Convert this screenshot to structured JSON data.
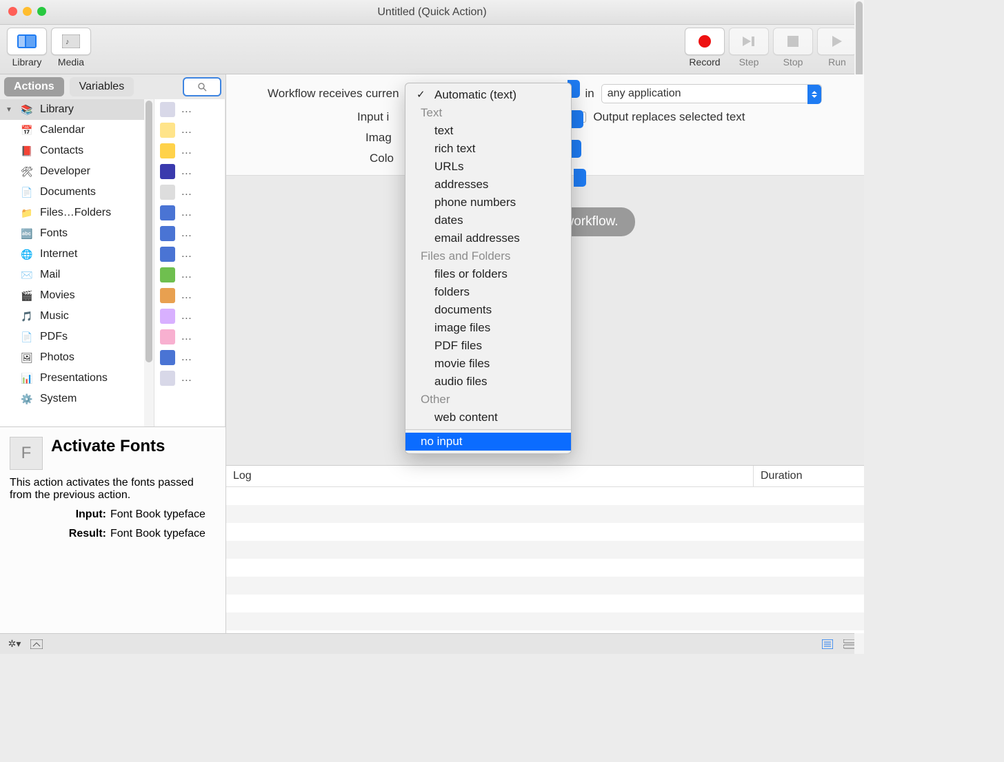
{
  "title": "Untitled (Quick Action)",
  "toolbar": {
    "library": "Library",
    "media": "Media",
    "record": "Record",
    "step": "Step",
    "stop": "Stop",
    "run": "Run"
  },
  "tabs": {
    "actions": "Actions",
    "variables": "Variables"
  },
  "sidebar": {
    "libraryHeader": "Library",
    "items": [
      {
        "label": "Calendar"
      },
      {
        "label": "Contacts"
      },
      {
        "label": "Developer"
      },
      {
        "label": "Documents"
      },
      {
        "label": "Files…Folders"
      },
      {
        "label": "Fonts"
      },
      {
        "label": "Internet"
      },
      {
        "label": "Mail"
      },
      {
        "label": "Movies"
      },
      {
        "label": "Music"
      },
      {
        "label": "PDFs"
      },
      {
        "label": "Photos"
      },
      {
        "label": "Presentations"
      },
      {
        "label": "System"
      }
    ]
  },
  "actions": {
    "rows": [
      "…",
      "…",
      "…",
      "…",
      "…",
      "…",
      "…",
      "…",
      "…",
      "…",
      "…",
      "…",
      "…",
      "…"
    ]
  },
  "detail": {
    "title": "Activate Fonts",
    "desc": "This action activates the fonts passed from the previous action.",
    "inputLabel": "Input:",
    "inputValue": "Font Book typeface",
    "resultLabel": "Result:",
    "resultValue": "Font Book typeface"
  },
  "config": {
    "receivesLabel": "Workflow receives curren",
    "inLabel": "in",
    "app": "any application",
    "inputLabel": "Input i",
    "outputReplaces": "Output replaces selected text",
    "imageLabel": "Imag",
    "colorLabel": "Colo"
  },
  "canvas": {
    "placeholder": "Drag                                          build your workflow."
  },
  "popup": {
    "top": "Automatic (text)",
    "sections": [
      {
        "title": "Text",
        "items": [
          "text",
          "rich text",
          "URLs",
          "addresses",
          "phone numbers",
          "dates",
          "email addresses"
        ]
      },
      {
        "title": "Files and Folders",
        "items": [
          "files or folders",
          "folders",
          "documents",
          "image files",
          "PDF files",
          "movie files",
          "audio files"
        ]
      },
      {
        "title": "Other",
        "items": [
          "web content"
        ]
      }
    ],
    "noinput": "no input"
  },
  "log": {
    "logCol": "Log",
    "durCol": "Duration"
  }
}
